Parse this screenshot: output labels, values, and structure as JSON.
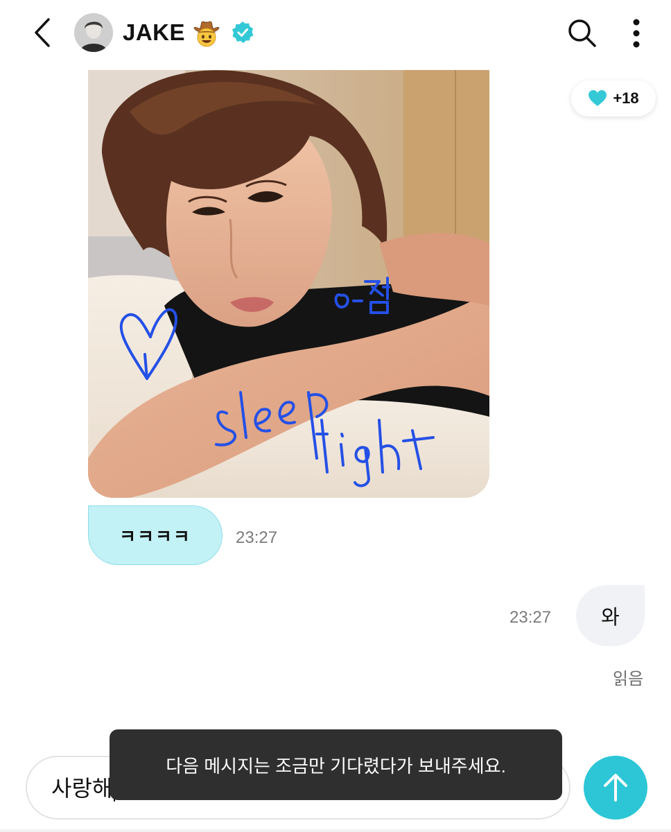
{
  "header": {
    "title": "JAKE",
    "title_emoji": "cowboy-face-emoji",
    "verified_icon": "verified-badge-icon",
    "back_icon": "chevron-left-icon",
    "search_icon": "search-icon",
    "more_icon": "more-vertical-icon"
  },
  "photo": {
    "handwriting_line1": "o-점",
    "handwriting_line2": "sleep",
    "handwriting_line3": "tight",
    "handwriting_heart": "heart-doodle"
  },
  "reaction": {
    "icon": "heart-icon",
    "count": "+18",
    "color": "#35c9d8"
  },
  "messages": [
    {
      "direction": "in",
      "text": "ㅋㅋㅋㅋ",
      "time": "23:27"
    },
    {
      "direction": "out",
      "text": "와",
      "time": "23:27",
      "status": "읽음"
    }
  ],
  "composer": {
    "value": "사랑해",
    "send_icon": "arrow-up-icon",
    "send_color": "#2cc6d6"
  },
  "toast": {
    "text": "다음 메시지는 조금만 기다렸다가 보내주세요."
  },
  "colors": {
    "accent": "#2cc6d6",
    "bubble_in": "#c2f1f6",
    "bubble_out": "#f1f2f6",
    "handwriting": "#2450e6"
  }
}
